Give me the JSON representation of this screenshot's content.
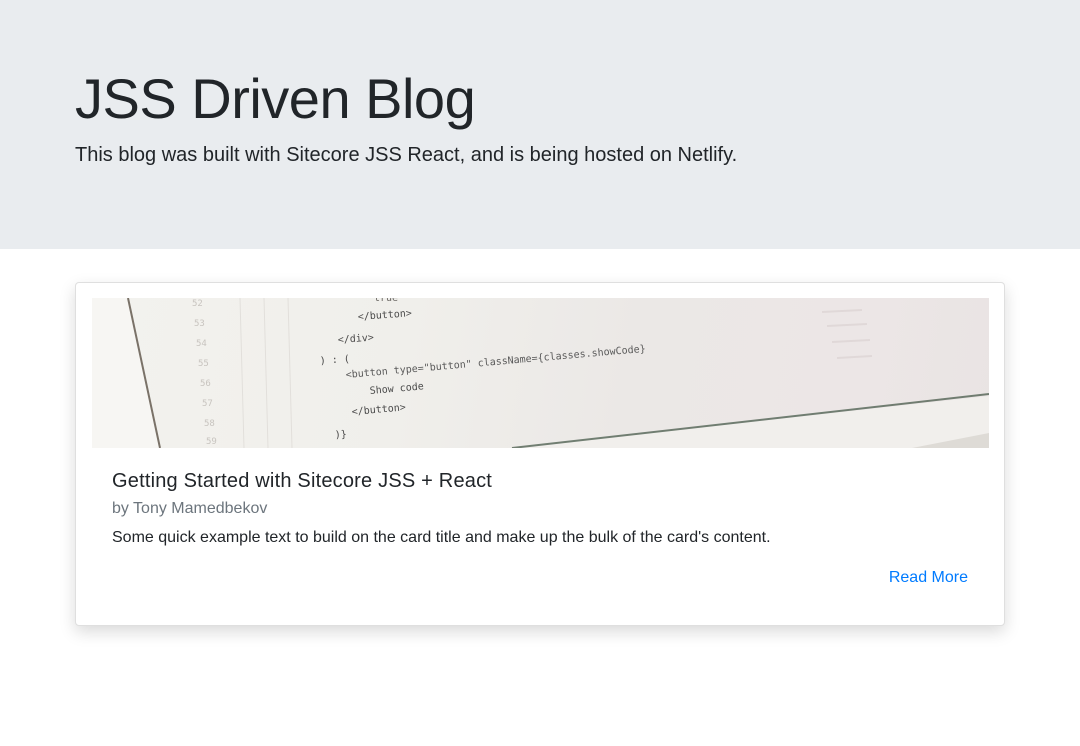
{
  "hero": {
    "title": "JSS Driven Blog",
    "lead": "This blog was built with Sitecore JSS React, and is being hosted on Netlify."
  },
  "card": {
    "image_code_lines": [
      "</button>",
      "</div>",
      ") : (",
      "<button type=\"button\" className={classes.showCode}",
      "Show code",
      "</button>",
      ")}"
    ],
    "title": "Getting Started with Sitecore JSS + React",
    "subtitle": "by Tony Mamedbekov",
    "text": "Some quick example text to build on the card title and make up the bulk of the card's content.",
    "link_label": "Read More"
  },
  "colors": {
    "hero_bg": "#e9ecef",
    "link": "#007bff",
    "muted": "#6c757d",
    "text": "#212529"
  }
}
